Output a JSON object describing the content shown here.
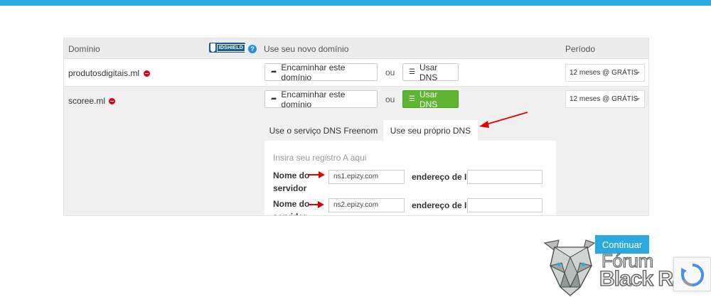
{
  "header": {
    "col_domain": "Domínio",
    "col_new_domain": "Use seu novo domínio",
    "col_period": "Período",
    "idshield_label": "IDSHIELD",
    "help_glyph": "?"
  },
  "rows": [
    {
      "domain": "produtosdigitais.ml",
      "forward_label": "Encaminhar este domínio",
      "or_label": "ou",
      "dns_label": "Usar DNS",
      "period": "12 meses @ GRÁTIS"
    },
    {
      "domain": "scoree.ml",
      "forward_label": "Encaminhar este domínio",
      "or_label": "ou",
      "dns_label": "Usar DNS",
      "period": "12 meses @ GRÁTIS"
    }
  ],
  "tabs": {
    "freenom": "Use o serviço DNS Freenom",
    "own": "Use seu próprio DNS"
  },
  "dns_panel": {
    "title": "Insira seu registro A aqui",
    "nameserver_label": "Nome do servidor",
    "ip_label": "endereço de IP",
    "nameservers": [
      {
        "value": "ns1.epizy.com",
        "ip": ""
      },
      {
        "value": "ns2.epizy.com",
        "ip": ""
      }
    ]
  },
  "continue_label": "Continuar",
  "watermark": {
    "line1": "Fórum",
    "line2": "Black Rat"
  },
  "colors": {
    "accent": "#2aa9e0",
    "active_green": "#5db530",
    "remove_red": "#d9001b",
    "arrow_red": "#e00000"
  }
}
